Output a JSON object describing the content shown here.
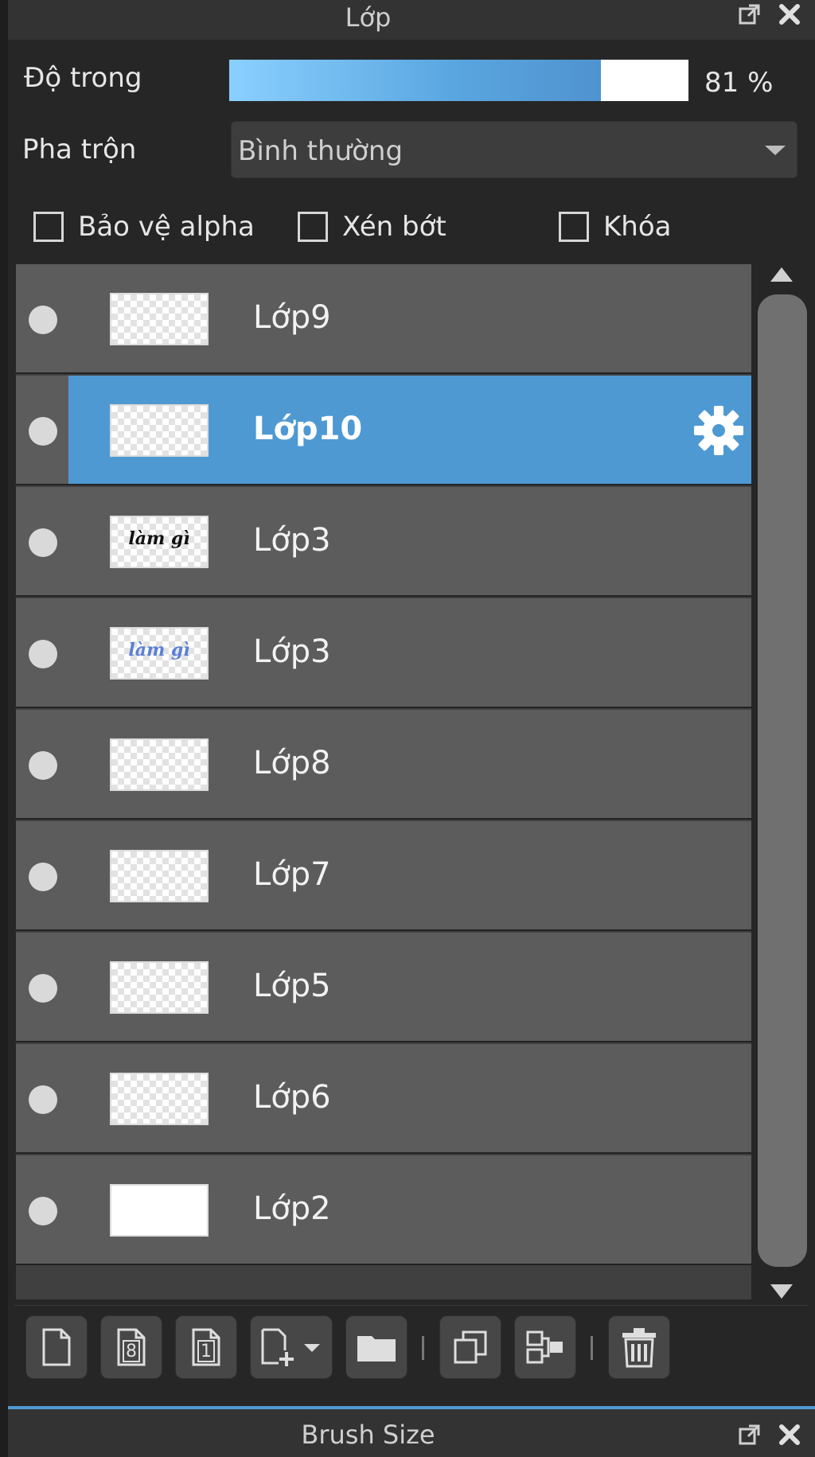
{
  "panel": {
    "title": "Lớp",
    "float_icon": "float-window-icon",
    "close_icon": "close-icon"
  },
  "opacity": {
    "label": "Độ trong",
    "value_text": "81 %",
    "value_fraction": 0.81
  },
  "blend": {
    "label": "Pha trộn",
    "selected": "Bình thường"
  },
  "checkboxes": {
    "protect_alpha": "Bảo vệ alpha",
    "clip": "Xén bớt",
    "lock": "Khóa"
  },
  "layers": [
    {
      "name": "Lớp9",
      "selected": false
    },
    {
      "name": "Lớp10",
      "selected": true
    },
    {
      "name": "Lớp3",
      "selected": false,
      "thumb_text": "làm gì",
      "thumb_color": "#111111"
    },
    {
      "name": "Lớp3",
      "selected": false,
      "thumb_text": "làm gì",
      "thumb_color": "#5a7fd6"
    },
    {
      "name": "Lớp8",
      "selected": false
    },
    {
      "name": "Lớp7",
      "selected": false
    },
    {
      "name": "Lớp5",
      "selected": false
    },
    {
      "name": "Lớp6",
      "selected": false
    },
    {
      "name": "Lớp2",
      "selected": false
    }
  ],
  "toolbar": {
    "icons": [
      "new-layer-icon",
      "layer-8bit-icon",
      "layer-1bit-icon",
      "add-layer-dropdown-icon",
      "folder-icon",
      "duplicate-icon",
      "merge-down-icon",
      "trash-icon"
    ]
  },
  "colors": {
    "accent": "#4f99d3",
    "row_bg": "#5c5c5c"
  },
  "bottom_panel": {
    "title": "Brush Size"
  }
}
